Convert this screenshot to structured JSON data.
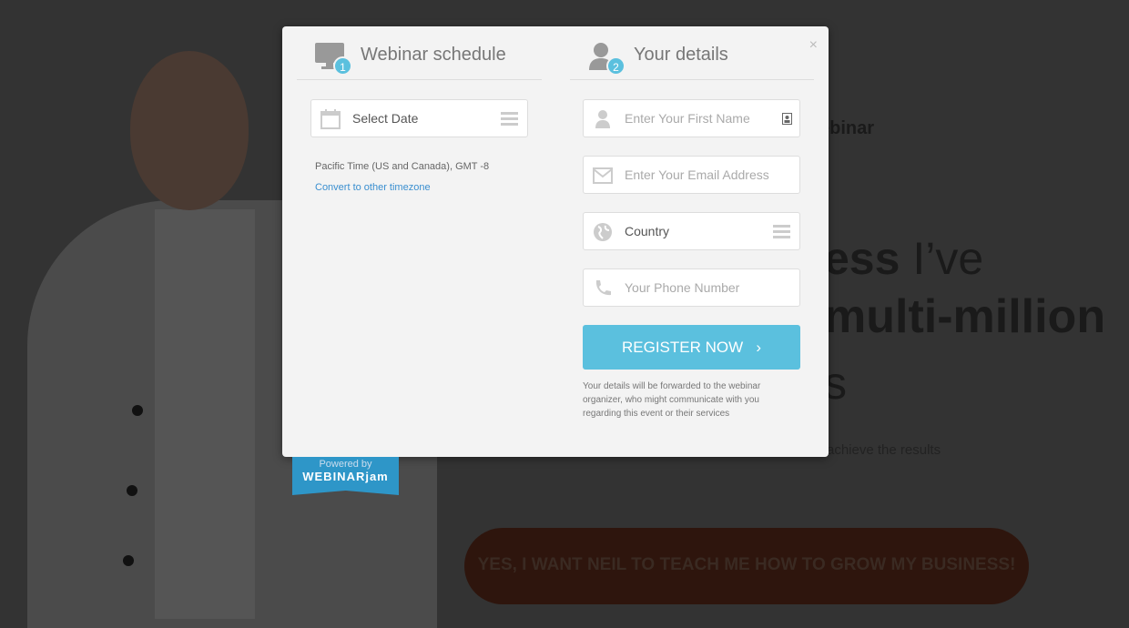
{
  "background": {
    "heading_fragment": "ebinar",
    "headline_line1_bold": "ess",
    "headline_line1_light": "I’ve",
    "headline_line2": "multi-million",
    "headline_line3": "s",
    "subtext_fragment": "achieve the results",
    "cta_label": "YES, I WANT NEIL TO TEACH ME HOW TO GROW MY BUSINESS!"
  },
  "modal": {
    "close_label": "×",
    "schedule": {
      "step": "1",
      "title": "Webinar schedule",
      "date_select": "Select Date",
      "timezone": "Pacific Time (US and Canada), GMT -8",
      "convert_link": "Convert to other timezone"
    },
    "details": {
      "step": "2",
      "title": "Your details",
      "first_name_placeholder": "Enter Your First Name",
      "email_placeholder": "Enter Your Email Address",
      "country_select": "Country",
      "phone_placeholder": "Your Phone Number",
      "register_label": "REGISTER NOW",
      "register_arrow": "›",
      "disclaimer": "Your details will be forwarded to the webinar organizer, who might communicate with you regarding this event or their services"
    }
  },
  "powered_by": {
    "line1": "Powered by",
    "logo": "WEBINARjam"
  },
  "colors": {
    "accent": "#5bc0de",
    "link": "#3a8fd0",
    "overlay": "#333333"
  }
}
